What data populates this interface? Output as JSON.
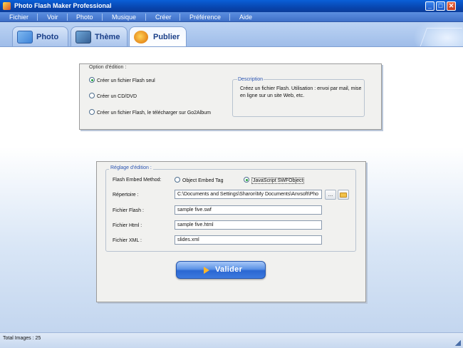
{
  "window": {
    "title": "Photo Flash Maker Professional",
    "min": "_",
    "max": "□",
    "close": "✕"
  },
  "menu": [
    "Fichier",
    "Voir",
    "Photo",
    "Musique",
    "Créer",
    "Préférence",
    "Aide"
  ],
  "tabs": [
    {
      "label": "Photo",
      "icon": "photo-icon",
      "active": false
    },
    {
      "label": "Thème",
      "icon": "theme-icon",
      "active": false
    },
    {
      "label": "Publier",
      "icon": "publish-icon",
      "active": true
    }
  ],
  "option": {
    "legend": "Option d'édition :",
    "radios": [
      {
        "label": "Créer un fichier Flash seul",
        "checked": true
      },
      {
        "label": "Créer un  CD/DVD",
        "checked": false
      },
      {
        "label": "Créer un fichier Flash, le télécharger sur Go2Album",
        "checked": false
      }
    ],
    "description_title": "Description",
    "description_text": "Créez un fichier Flash. Utilisation : envoi par mail, mise en ligne sur un site Web, etc."
  },
  "settings": {
    "legend": "Réglage d'édition :",
    "embed_label": "Flash Embed Method:",
    "embed_options": [
      {
        "label": "Object Embed Tag",
        "checked": false
      },
      {
        "label": "JavaScript SWFObject",
        "checked": true
      }
    ],
    "directory_label": "Répertoire :",
    "directory_value": "C:\\Documents and Settings\\Sharon\\My Documents\\Anvsoft\\Pho",
    "browse_label": "...",
    "flash_label": "Fichier Flash :",
    "flash_value": "sample five.swf",
    "html_label": "Fichier Html :",
    "html_value": "sample five.html",
    "xml_label": "Fichier XML :",
    "xml_value": "slides.xml"
  },
  "valider_label": "Valider",
  "status": {
    "text": "Total Images : 25"
  }
}
